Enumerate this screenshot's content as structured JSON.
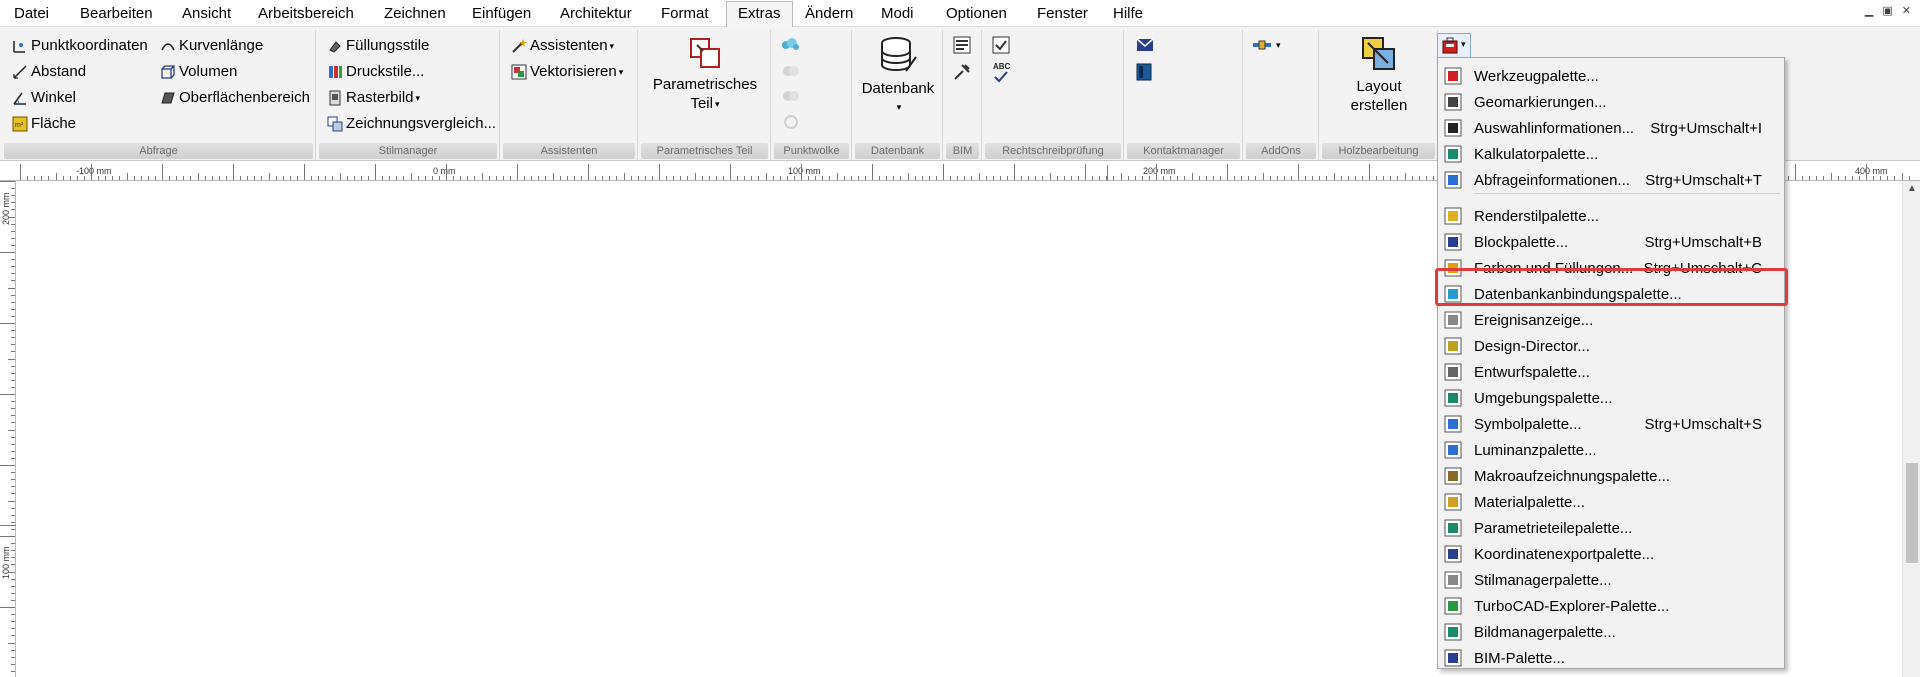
{
  "menubar": {
    "items": [
      {
        "label": "Datei"
      },
      {
        "label": "Bearbeiten"
      },
      {
        "label": "Ansicht"
      },
      {
        "label": "Arbeitsbereich"
      },
      {
        "label": "Zeichnen"
      },
      {
        "label": "Einfügen"
      },
      {
        "label": "Architektur"
      },
      {
        "label": "Format"
      },
      {
        "label": "Extras"
      },
      {
        "label": "Ändern"
      },
      {
        "label": "Modi"
      },
      {
        "label": "Optionen"
      },
      {
        "label": "Fenster"
      },
      {
        "label": "Hilfe"
      }
    ],
    "active": "Extras"
  },
  "ribbon": {
    "abfrage": {
      "label": "Abfrage",
      "items": [
        "Punktkoordinaten",
        "Kurvenlänge",
        "Abstand",
        "Volumen",
        "Winkel",
        "Oberflächenbereich",
        "Fläche"
      ]
    },
    "stilmanager": {
      "label": "Stilmanager",
      "items": [
        "Füllungsstile",
        "Druckstile...",
        "Rasterbild",
        "Zeichnungsvergleich..."
      ]
    },
    "assistenten": {
      "label": "Assistenten",
      "items": [
        "Assistenten",
        "Vektorisieren"
      ]
    },
    "parametrisches_teil": {
      "label": "Parametrisches Teil",
      "button_line1": "Parametrisches",
      "button_line2": "Teil"
    },
    "punktwolke": {
      "label": "Punktwolke"
    },
    "datenbank": {
      "label": "Datenbank",
      "button": "Datenbank"
    },
    "bim": {
      "label": "BIM"
    },
    "rechtschreibpruefung": {
      "label": "Rechtschreibprüfung",
      "abc": "ABC"
    },
    "kontaktmanager": {
      "label": "Kontaktmanager"
    },
    "addons": {
      "label": "AddOns"
    },
    "holzbearbeitung": {
      "label": "Holzbearbeitung",
      "button_line1": "Layout",
      "button_line2": "erstellen"
    }
  },
  "ruler": {
    "h_labels": [
      "-100 mm",
      "0 mm",
      "100 mm",
      "200 mm",
      "400 mm"
    ],
    "v_labels": [
      "200 mm",
      "100 mm"
    ]
  },
  "dropdown": {
    "items": [
      {
        "label": "Werkzeugpalette...",
        "shortcut": "",
        "icon": "toolbox-icon"
      },
      {
        "label": "Geomarkierungen...",
        "shortcut": "",
        "icon": "binoculars-icon"
      },
      {
        "label": "Auswahlinformationen...",
        "shortcut": "Strg+Umschalt+I",
        "icon": "cursor-icon"
      },
      {
        "label": "Kalkulatorpalette...",
        "shortcut": "",
        "icon": "calculator-icon"
      },
      {
        "label": "Abfrageinformationen...",
        "shortcut": "Strg+Umschalt+T",
        "icon": "query-icon"
      },
      {
        "label": "Renderstilpalette...",
        "shortcut": "",
        "icon": "render-icon"
      },
      {
        "label": "Blockpalette...",
        "shortcut": "Strg+Umschalt+B",
        "icon": "block-icon"
      },
      {
        "label": "Farben und Füllungen...",
        "shortcut": "Strg+Umschalt+C",
        "icon": "palette-icon"
      },
      {
        "label": "Datenbankanbindungspalette...",
        "shortcut": "",
        "icon": "database-icon"
      },
      {
        "label": "Ereignisanzeige...",
        "shortcut": "",
        "icon": "event-icon"
      },
      {
        "label": "Design-Director...",
        "shortcut": "",
        "icon": "director-icon"
      },
      {
        "label": "Entwurfspalette...",
        "shortcut": "",
        "icon": "draft-icon"
      },
      {
        "label": "Umgebungspalette...",
        "shortcut": "",
        "icon": "environment-icon"
      },
      {
        "label": "Symbolpalette...",
        "shortcut": "Strg+Umschalt+S",
        "icon": "symbol-icon"
      },
      {
        "label": "Luminanzpalette...",
        "shortcut": "",
        "icon": "luminance-icon"
      },
      {
        "label": "Makroaufzeichnungspalette...",
        "shortcut": "",
        "icon": "macro-icon"
      },
      {
        "label": "Materialpalette...",
        "shortcut": "",
        "icon": "material-icon"
      },
      {
        "label": "Parametrieteilepalette...",
        "shortcut": "",
        "icon": "parametric-icon"
      },
      {
        "label": "Koordinatenexportpalette...",
        "shortcut": "",
        "icon": "coord-export-icon"
      },
      {
        "label": "Stilmanagerpalette...",
        "shortcut": "",
        "icon": "style-manager-icon"
      },
      {
        "label": "TurboCAD-Explorer-Palette...",
        "shortcut": "",
        "icon": "explorer-icon"
      },
      {
        "label": "Bildmanagerpalette...",
        "shortcut": "",
        "icon": "image-manager-icon"
      },
      {
        "label": "BIM-Palette...",
        "shortcut": "",
        "icon": "bim-icon"
      }
    ],
    "highlighted": "Datenbankanbindungspalette..."
  },
  "colors": {
    "highlight_border": "#e03c3c",
    "ruler_marker": "#d040d0"
  }
}
